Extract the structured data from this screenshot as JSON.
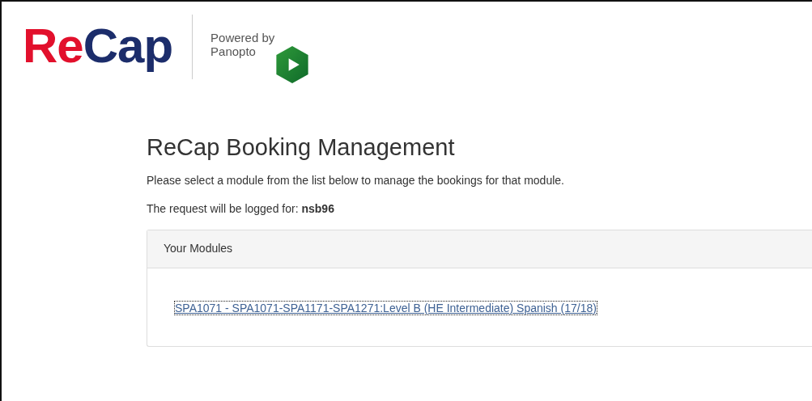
{
  "logo": {
    "parts": [
      {
        "text": "Re",
        "color": "#e2102c"
      },
      {
        "text": "Cap",
        "color": "#1c2d6b"
      }
    ]
  },
  "powered_by": {
    "line_1": "Powered by",
    "line_2": "Panopto"
  },
  "heading": "ReCap Booking Management",
  "intro": "Please select a module from the list below to manage the bookings for that module.",
  "logged_for": "The request will be logged for: **nsb96**",
  "panel": {
    "title": "Your Modules",
    "modules": [
      {
        "label": "SPA1071 - SPA1071-SPA1171-SPA1271:Level B (HE Intermediate) Spanish (17/18)",
        "focused": true
      }
    ]
  }
}
